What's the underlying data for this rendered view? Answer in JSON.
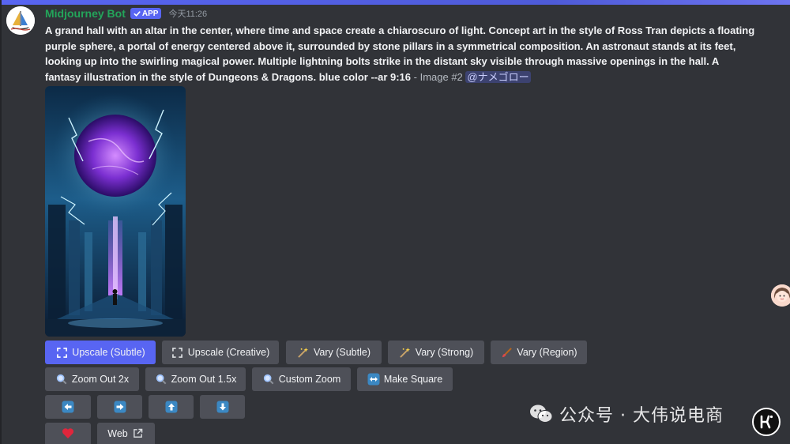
{
  "message": {
    "username": "Midjourney Bot",
    "badge_label": "APP",
    "timestamp": "今天11:26",
    "prompt_text": "A grand hall with an altar in the center, where time and space create a chiaroscuro of light. Concept art in the style of Ross Tran depicts a floating purple sphere, a portal of energy centered above it, surrounded by stone pillars in a symmetrical composition. An astronaut stands at its feet, looking up into the swirling magical power. Multiple lightning bolts strike in the distant sky visible through massive openings in the hall. A fantasy illustration in the style of Dungeons & Dragons. blue color --ar 9:16",
    "suffix": " - Image #2 ",
    "mention": "@ナメゴロー"
  },
  "buttons": {
    "upscale_subtle": "Upscale (Subtle)",
    "upscale_creative": "Upscale (Creative)",
    "vary_subtle": "Vary (Subtle)",
    "vary_strong": "Vary (Strong)",
    "vary_region": "Vary (Region)",
    "zoom_out_2x": "Zoom Out 2x",
    "zoom_out_1_5x": "Zoom Out 1.5x",
    "custom_zoom": "Custom Zoom",
    "make_square": "Make Square",
    "web": "Web"
  },
  "icons": {
    "pan_left": "arrow-left-icon",
    "pan_right": "arrow-right-icon",
    "pan_up": "arrow-up-icon",
    "pan_down": "arrow-down-icon",
    "favorite": "heart-icon",
    "external": "external-link-icon"
  },
  "watermark": {
    "text": "公众号 · 大伟说电商"
  },
  "colors": {
    "accent": "#5865f2",
    "username": "#23a55a",
    "button": "#4e5058",
    "background": "#313338",
    "heart": "#e0263c"
  }
}
